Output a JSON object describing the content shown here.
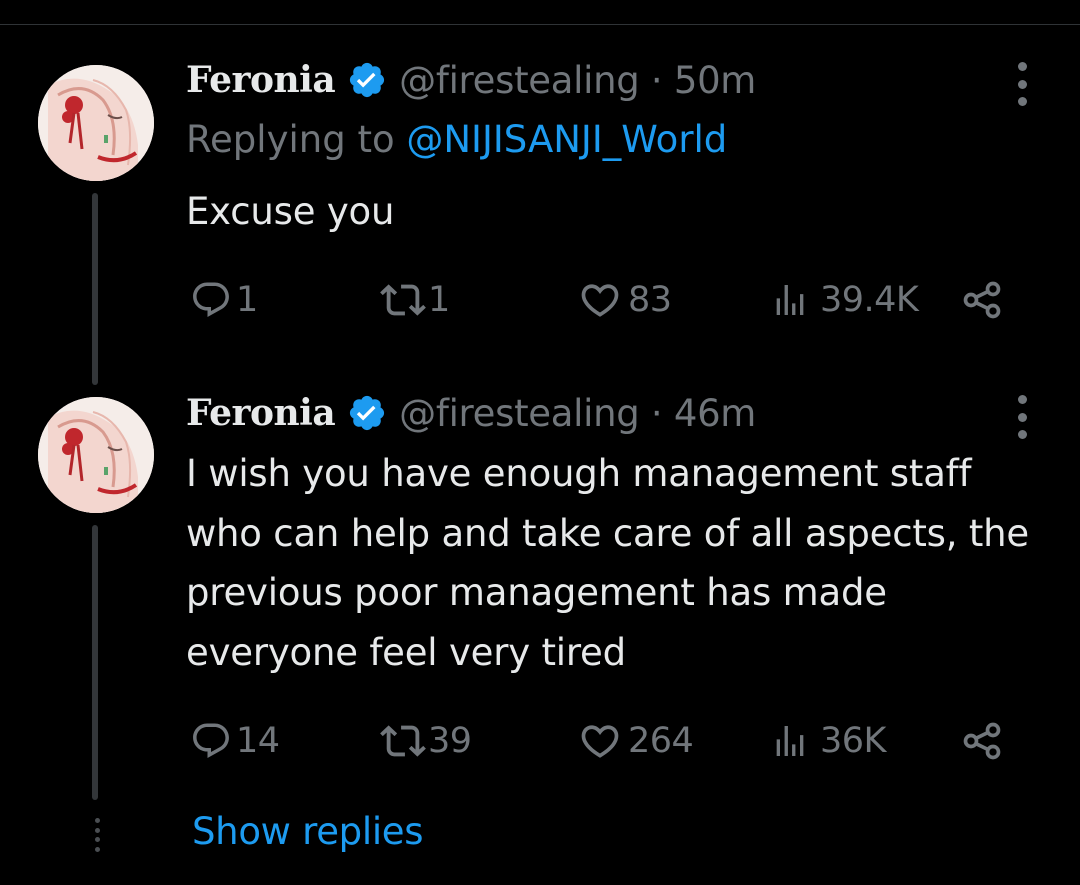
{
  "tweets": [
    {
      "name": "Feronia",
      "handle_meta": "@firestealing · 50m",
      "replying_prefix": "Replying to ",
      "replying_handle": "@NIJISANJI_World",
      "text": "Excuse you",
      "replies": "1",
      "retweets": "1",
      "likes": "83",
      "views": "39.4K"
    },
    {
      "name": "Feronia",
      "handle_meta": "@firestealing · 46m",
      "text": "I wish you have enough management staff who can help and take care of all aspects, the previous poor management has made everyone feel very tired",
      "replies": "14",
      "retweets": "39",
      "likes": "264",
      "views": "36K"
    }
  ],
  "show_replies_label": "Show replies",
  "icons": {
    "reply": "reply-icon",
    "retweet": "retweet-icon",
    "like": "heart-icon",
    "views": "views-chart-icon",
    "share": "share-icon",
    "verified": "verified-badge-icon",
    "more": "more-vertical-icon"
  },
  "colors": {
    "background": "#000000",
    "primary_text": "#e7e9ea",
    "secondary_text": "#71767b",
    "accent": "#1d9bf0",
    "thread_line": "#333639"
  }
}
